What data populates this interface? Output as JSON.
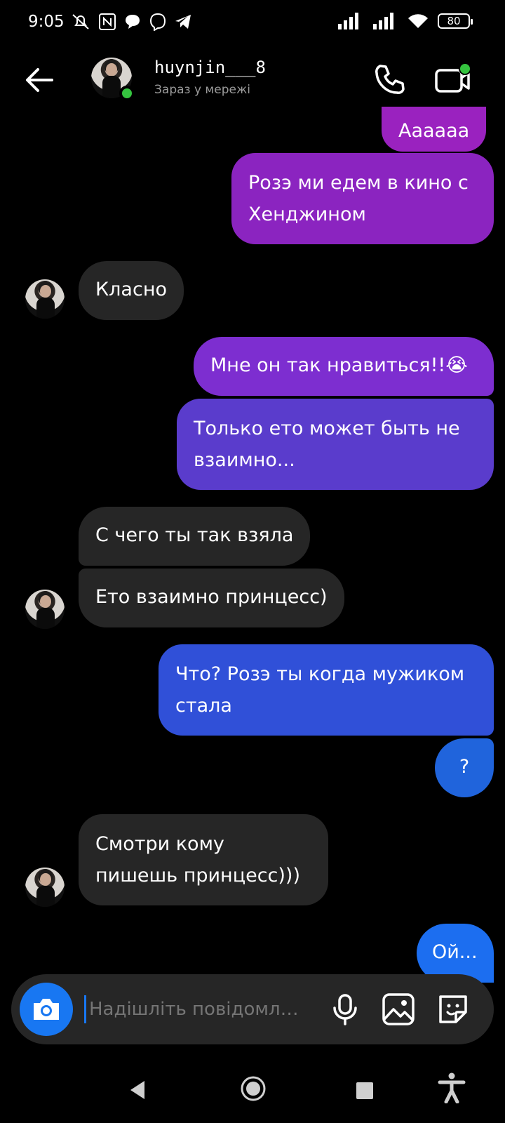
{
  "status_bar": {
    "time": "9:05",
    "battery": "80"
  },
  "header": {
    "back_icon": "back-arrow-icon",
    "contact_name": "huynjin___8",
    "contact_status": "Зараз у мережі",
    "call_icon": "phone-icon",
    "video_icon": "video-camera-icon"
  },
  "messages": [
    {
      "side": "out",
      "text": "Аааааа"
    },
    {
      "side": "out",
      "text": "Розэ ми едем в кино с Хенджином"
    },
    {
      "side": "in",
      "text": "Класно"
    },
    {
      "side": "out",
      "text": "Мне он так нравиться!!😭"
    },
    {
      "side": "out",
      "text": "Только ето может быть не взаимно..."
    },
    {
      "side": "in",
      "text": "С чего ты так взяла"
    },
    {
      "side": "in",
      "text": "Ето взаимно принцесс)"
    },
    {
      "side": "out",
      "text": "Что? Розэ ты когда мужиком стала"
    },
    {
      "side": "out",
      "text": "?"
    },
    {
      "side": "in",
      "text": "Смотри кому пишешь принцесс)))"
    },
    {
      "side": "out",
      "text": "Ой..."
    }
  ],
  "composer": {
    "placeholder": "Надішліть повідомл…",
    "camera_icon": "camera-icon",
    "mic_icon": "microphone-icon",
    "gallery_icon": "gallery-icon",
    "sticker_icon": "sticker-icon"
  },
  "colors": {
    "accent": "#1877f2",
    "online": "#35c43f",
    "incoming_bubble": "#262626",
    "gradient_top": "#a020b8",
    "gradient_mid": "#6b3dd6",
    "gradient_bottom": "#1f6fe8"
  }
}
